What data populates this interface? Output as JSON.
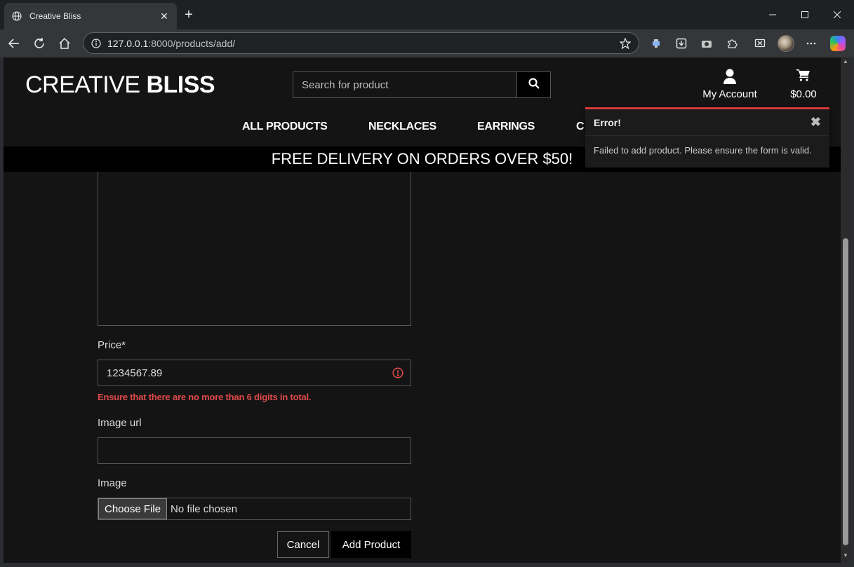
{
  "browser": {
    "tab_title": "Creative Bliss",
    "url_host": "127.0.0.1",
    "url_path": ":8000/products/add/"
  },
  "site": {
    "logo_regular": "CREATIVE",
    "logo_bold": "BLISS",
    "search_placeholder": "Search for product",
    "account_label": "My Account",
    "cart_total": "$0.00",
    "nav": [
      "ALL PRODUCTS",
      "NECKLACES",
      "EARRINGS",
      "C"
    ],
    "banner": "FREE DELIVERY ON ORDERS OVER $50!"
  },
  "form": {
    "price_label": "Price*",
    "price_value": "1234567.89",
    "price_error": "Ensure that there are no more than 6 digits in total.",
    "image_url_label": "Image url",
    "image_url_value": "",
    "image_label": "Image",
    "choose_file": "Choose File",
    "no_file": "No file chosen",
    "cancel": "Cancel",
    "submit": "Add Product"
  },
  "toast": {
    "title": "Error!",
    "message": "Failed to add product. Please ensure the form is valid.",
    "accent_color": "#d63a3a"
  },
  "icons": {
    "tab_favicon": "globe-icon",
    "search": "search-icon",
    "account": "user-icon",
    "cart": "cart-icon",
    "error": "exclamation-circle-icon",
    "close": "close-icon"
  }
}
